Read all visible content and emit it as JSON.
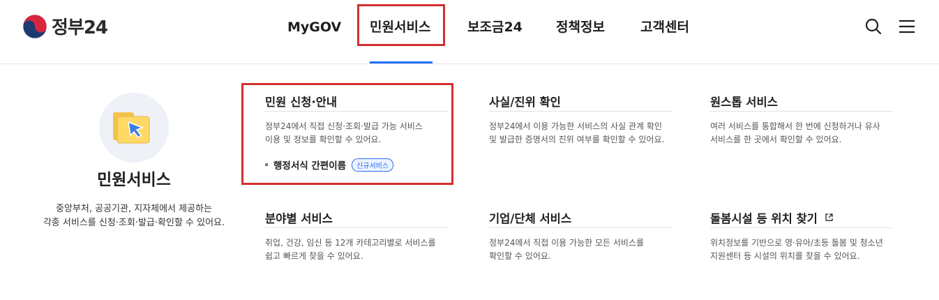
{
  "header": {
    "logo_text": "정부24",
    "nav": [
      {
        "label": "MyGOV"
      },
      {
        "label": "민원서비스"
      },
      {
        "label": "보조금24"
      },
      {
        "label": "정책정보"
      },
      {
        "label": "고객센터"
      }
    ],
    "active_nav": "민원서비스",
    "icons": [
      "search-icon",
      "menu-icon"
    ]
  },
  "intro": {
    "title": "민원서비스",
    "desc_line1": "중앙부처, 공공기관, 지자체에서 제공하는",
    "desc_line2": "각종 서비스를 신청·조회·발급·확인할 수 있어요."
  },
  "cards": [
    {
      "title": "민원 신청·안내",
      "desc_line1": "정부24에서 직접 신청·조회·발급 가능 서비스",
      "desc_line2": "이용 및 정보를 확인할 수 있어요.",
      "sub_link": "행정서식 간편이름",
      "badge": "신규서비스"
    },
    {
      "title": "사실/진위 확인",
      "desc_line1": "정부24에서 이용 가능한 서비스의 사실 관계 확인",
      "desc_line2": "및 발급한 증명서의 진위 여부를 확인할 수 있어요."
    },
    {
      "title": "원스톱 서비스",
      "desc_line1": "여러 서비스를 통합해서 한 번에 신청하거나 유사",
      "desc_line2": "서비스를 한 곳에서 확인할 수 있어요."
    },
    {
      "title": "분야별 서비스",
      "desc_line1": "취업, 건강, 임신 등 12개 카테고리별로 서비스를",
      "desc_line2": "쉽고 빠르게 찾을 수 있어요."
    },
    {
      "title": "기업/단체 서비스",
      "desc_line1": "정부24에서 직접 이용 가능한 모든 서비스를",
      "desc_line2": "확인할 수 있어요."
    },
    {
      "title": "돌봄시설 등 위치 찾기",
      "desc_line1": "위치정보를 기반으로 영·유아/초등 돌봄 및 청소년",
      "desc_line2": "지원센터 등 시설의 위치를 찾을 수 있어요."
    }
  ],
  "colors": {
    "accent": "#256ef4",
    "highlight": "#d32f2f",
    "text": "#1e1e1e",
    "muted": "#555555"
  }
}
